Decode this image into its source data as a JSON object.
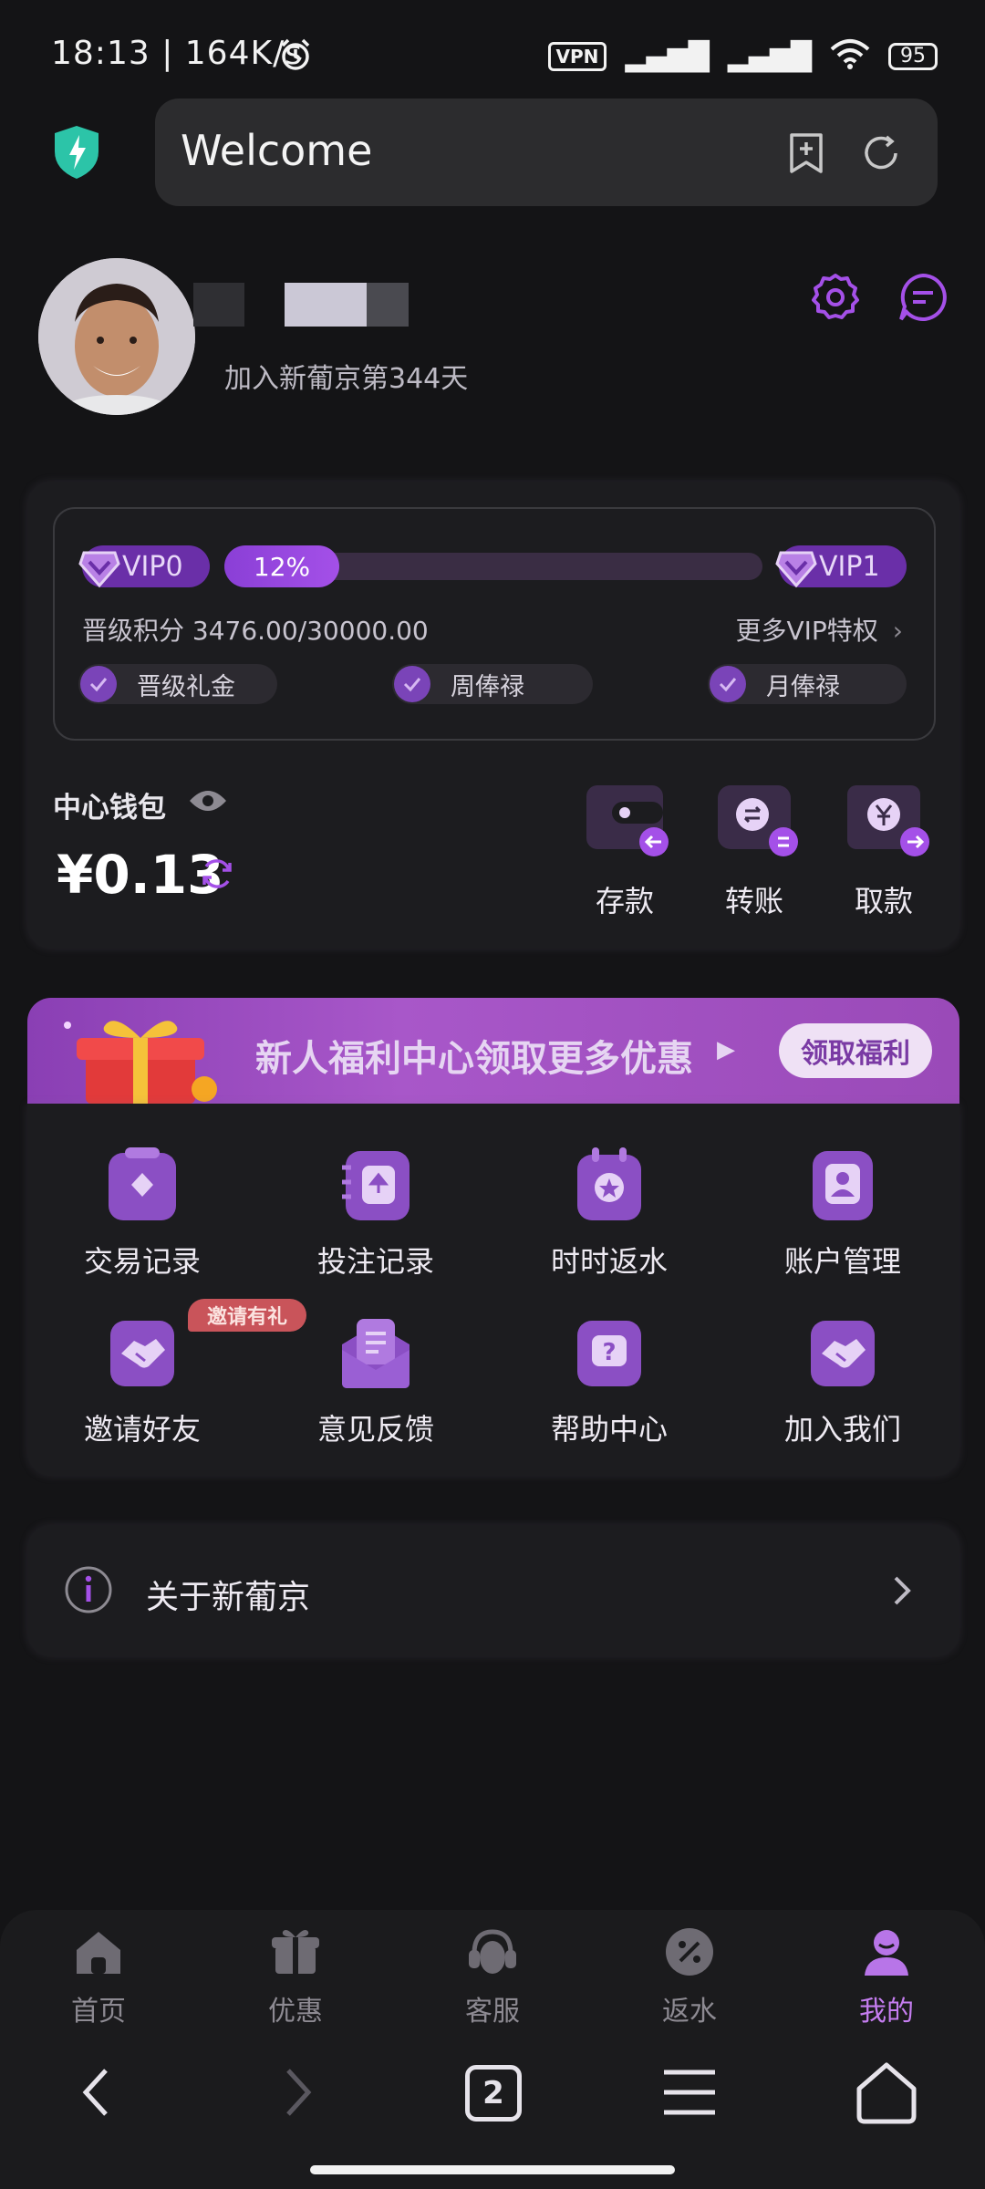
{
  "status_bar": {
    "time": "18:13 | 164K/s",
    "vpn": "VPN",
    "battery": "95"
  },
  "browser": {
    "url_text": "Welcome"
  },
  "profile": {
    "join_text": "加入新葡京第344天"
  },
  "vip": {
    "current_level": "VIP0",
    "next_level": "VIP1",
    "progress_label": "12%",
    "progress_value": 0.12,
    "points_text": "晋级积分 3476.00/30000.00",
    "more_link": "更多VIP特权",
    "perks": [
      "晋级礼金",
      "周俸禄",
      "月俸禄"
    ]
  },
  "wallet": {
    "label": "中心钱包",
    "balance": "¥0.13",
    "actions": [
      "存款",
      "转账",
      "取款"
    ]
  },
  "banner": {
    "text": "新人福利中心领取更多优惠",
    "button": "领取福利"
  },
  "grid": {
    "items": [
      "交易记录",
      "投注记录",
      "时时返水",
      "账户管理",
      "邀请好友",
      "意见反馈",
      "帮助中心",
      "加入我们"
    ],
    "invite_tag": "邀请有礼"
  },
  "about": {
    "label": "关于新葡京"
  },
  "bottom_nav": {
    "tabs": [
      "首页",
      "优惠",
      "客服",
      "返水",
      "我的"
    ],
    "active": "我的",
    "tab_count": "2"
  },
  "colors": {
    "accent": "#a450e8",
    "background": "#141416",
    "card": "#1c1c1f"
  }
}
